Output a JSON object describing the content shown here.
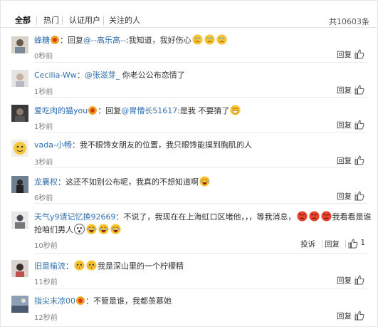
{
  "tabs": [
    {
      "label": "全部"
    },
    {
      "label": "热门"
    },
    {
      "label": "认证用户"
    },
    {
      "label": "关注的人"
    }
  ],
  "total_count": "共10603条",
  "action_labels": {
    "reply": "回复",
    "report": "投诉"
  },
  "colors": {
    "link": "#2f6fb0",
    "badge": "#f0a020",
    "emoji": "#f7c42f",
    "red_emoji": "#e8432d"
  },
  "comments": [
    {
      "username": "蜂糖",
      "text_prefix": "：回复",
      "mention": "@--高乐高--",
      "text": ":我知道，我好伤心",
      "time": "0秒前",
      "emojis": [
        "crying-emoji",
        "crying-emoji",
        "crying-emoji"
      ]
    },
    {
      "username": "Cecilia-Ww",
      "text_prefix": "：",
      "mention": "@张滋芽_",
      "text": " 你老公公布恋情了",
      "time": "1秒前"
    },
    {
      "username": "爱吃肉的猫you",
      "text_prefix": "：回复",
      "mention": "@胃懵长51617",
      "text": ":是我 不要猜了",
      "time": "1秒前",
      "emojis": [
        "grin-emoji"
      ]
    },
    {
      "username": "vada-小畅",
      "text_prefix": "：",
      "mention": "",
      "text": "我不眼馋女朋友的位置，我只眼馋能摸到胸肌的人",
      "time": "3秒前"
    },
    {
      "username": "龙襄权",
      "text_prefix": "：",
      "mention": "",
      "text": "这还不如别公布呢，我真的不想知道啊",
      "time": "6秒前",
      "emojis": [
        "laugh-cry-emoji"
      ]
    },
    {
      "username": "天气y9请记忆换92669",
      "text_prefix": "：",
      "mention": "",
      "text": "不说了，我现在在上海虹口区堵他，，，等我消息，",
      "text_suffix": "我看看是谁",
      "line2": "抢咱们男人",
      "time": "10秒前",
      "like_count": "1",
      "emojis": [
        "angry-emoji",
        "angry-emoji",
        "angry-emoji"
      ],
      "line2_emojis": [
        "shocked-emoji",
        "laugh-cry-emoji",
        "laugh-cry-emoji",
        "laugh-cry-emoji"
      ]
    },
    {
      "username": "旧是榆流",
      "text_prefix": "：",
      "mention": "",
      "text": "我是深山里的一个柠檬精",
      "time": "11秒前",
      "emojis": [
        "shy-emoji",
        "shy-emoji"
      ]
    },
    {
      "username": "指尖末凉00",
      "text_prefix": "：",
      "mention": "",
      "text": "不管是谁，我都羡慕她",
      "time": "12秒前"
    }
  ]
}
